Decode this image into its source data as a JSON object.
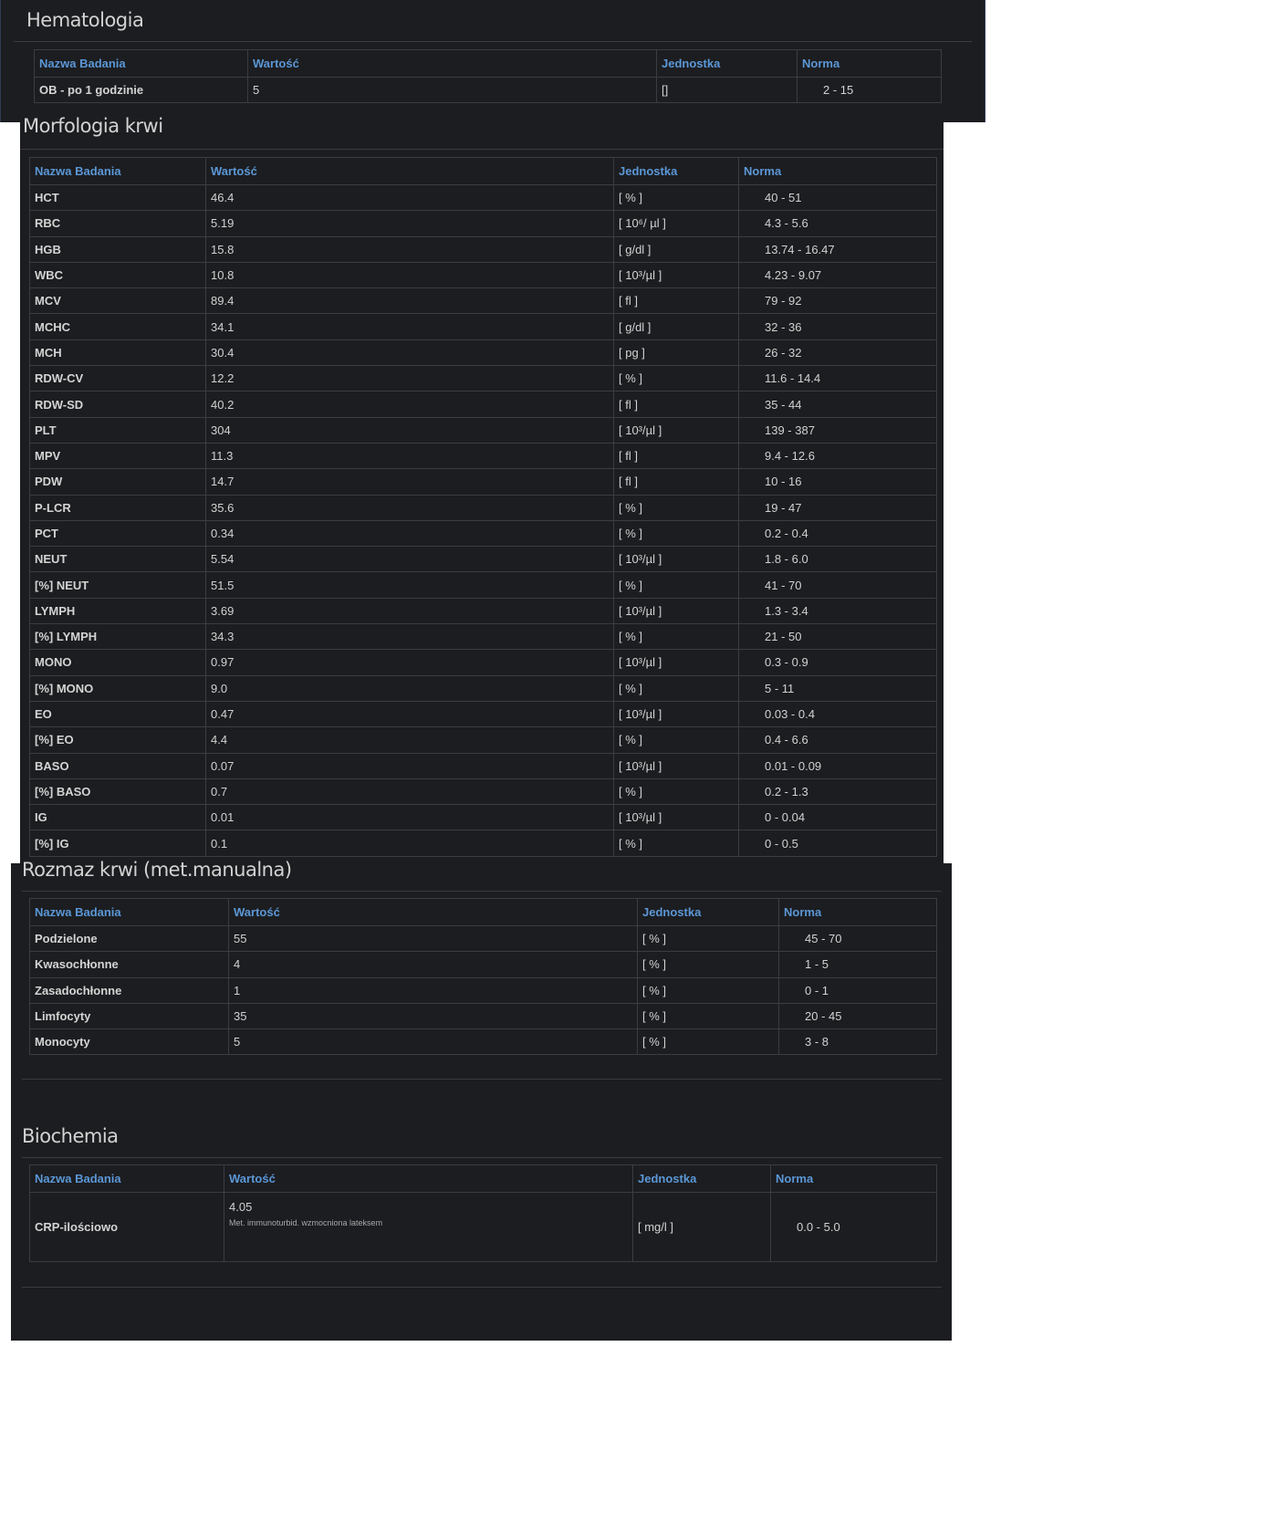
{
  "columns": {
    "name": "Nazwa Badania",
    "value": "Wartość",
    "unit": "Jednostka",
    "norm": "Norma"
  },
  "hematologia": {
    "title": "Hematologia",
    "rows": [
      {
        "name": "OB - po 1 godzinie",
        "value": "5",
        "unit": "[]",
        "norm": "2 - 15"
      }
    ]
  },
  "morfologia": {
    "title": "Morfologia krwi",
    "rows": [
      {
        "name": "HCT",
        "value": "46.4",
        "unit": "[ % ]",
        "norm": "40 - 51"
      },
      {
        "name": "RBC",
        "value": "5.19",
        "unit": "[ 10⁶/ µl ]",
        "norm": "4.3 - 5.6"
      },
      {
        "name": "HGB",
        "value": "15.8",
        "unit": "[ g/dl ]",
        "norm": "13.74 - 16.47"
      },
      {
        "name": "WBC",
        "value": "10.8",
        "unit": "[ 10³/µl ]",
        "norm": "4.23 - 9.07"
      },
      {
        "name": "MCV",
        "value": "89.4",
        "unit": "[ fl ]",
        "norm": "79 - 92"
      },
      {
        "name": "MCHC",
        "value": "34.1",
        "unit": "[ g/dl ]",
        "norm": "32 - 36"
      },
      {
        "name": "MCH",
        "value": "30.4",
        "unit": "[ pg ]",
        "norm": "26 - 32"
      },
      {
        "name": "RDW-CV",
        "value": "12.2",
        "unit": "[ % ]",
        "norm": "11.6 - 14.4"
      },
      {
        "name": "RDW-SD",
        "value": "40.2",
        "unit": "[ fl ]",
        "norm": "35 - 44"
      },
      {
        "name": "PLT",
        "value": "304",
        "unit": "[ 10³/µl ]",
        "norm": "139 - 387"
      },
      {
        "name": "MPV",
        "value": "11.3",
        "unit": "[ fl ]",
        "norm": "9.4 - 12.6"
      },
      {
        "name": "PDW",
        "value": "14.7",
        "unit": "[ fl ]",
        "norm": "10 - 16"
      },
      {
        "name": "P-LCR",
        "value": "35.6",
        "unit": "[ % ]",
        "norm": "19 - 47"
      },
      {
        "name": "PCT",
        "value": "0.34",
        "unit": "[ % ]",
        "norm": "0.2 - 0.4"
      },
      {
        "name": "NEUT",
        "value": "5.54",
        "unit": "[ 10³/µl ]",
        "norm": "1.8 - 6.0"
      },
      {
        "name": "[%] NEUT",
        "value": "51.5",
        "unit": "[ % ]",
        "norm": "41 - 70"
      },
      {
        "name": "LYMPH",
        "value": "3.69",
        "unit": "[ 10³/µl ]",
        "norm": "1.3 - 3.4"
      },
      {
        "name": "[%] LYMPH",
        "value": "34.3",
        "unit": "[ % ]",
        "norm": "21 - 50"
      },
      {
        "name": "MONO",
        "value": "0.97",
        "unit": "[ 10³/µl ]",
        "norm": "0.3 - 0.9"
      },
      {
        "name": "[%] MONO",
        "value": "9.0",
        "unit": "[ % ]",
        "norm": "5 - 11"
      },
      {
        "name": "EO",
        "value": "0.47",
        "unit": "[ 10³/µl ]",
        "norm": "0.03 - 0.4"
      },
      {
        "name": "[%] EO",
        "value": "4.4",
        "unit": "[ % ]",
        "norm": "0.4 - 6.6"
      },
      {
        "name": "BASO",
        "value": "0.07",
        "unit": "[ 10³/µl ]",
        "norm": "0.01 - 0.09"
      },
      {
        "name": "[%] BASO",
        "value": "0.7",
        "unit": "[ % ]",
        "norm": "0.2 - 1.3"
      },
      {
        "name": "IG",
        "value": "0.01",
        "unit": "[ 10³/µl ]",
        "norm": "0 - 0.04"
      },
      {
        "name": "[%] IG",
        "value": "0.1",
        "unit": "[ % ]",
        "norm": "0 - 0.5"
      }
    ]
  },
  "rozmaz": {
    "title": "Rozmaz krwi (met.manualna)",
    "rows": [
      {
        "name": "Podzielone",
        "value": "55",
        "unit": "[ % ]",
        "norm": "45 - 70"
      },
      {
        "name": "Kwasochłonne",
        "value": "4",
        "unit": "[ % ]",
        "norm": "1 - 5"
      },
      {
        "name": "Zasadochłonne",
        "value": "1",
        "unit": "[ % ]",
        "norm": "0 - 1"
      },
      {
        "name": "Limfocyty",
        "value": "35",
        "unit": "[ % ]",
        "norm": "20 - 45"
      },
      {
        "name": "Monocyty",
        "value": "5",
        "unit": "[ % ]",
        "norm": "3 - 8"
      }
    ]
  },
  "biochemia": {
    "title": "Biochemia",
    "rows": [
      {
        "name": "CRP-ilościowo",
        "value": "4.05",
        "method": "Met. immunoturbid. wzmocniona lateksem",
        "unit": "[ mg/l ]",
        "norm": "0.0 - 5.0"
      }
    ]
  }
}
